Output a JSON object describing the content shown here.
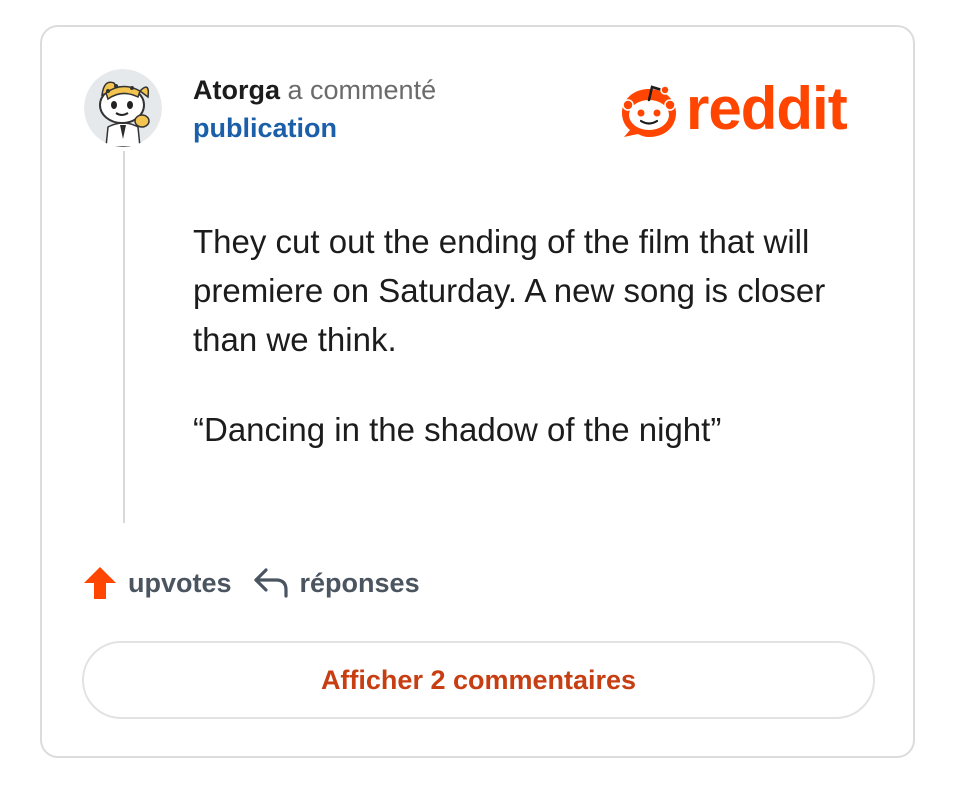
{
  "comment": {
    "author": "Atorga",
    "action_text": "a commenté",
    "post_link": "publication",
    "body": [
      "They cut out the ending of the film that will premiere on Saturday. A new song is closer than we think.",
      "“Dancing in the shadow of the night”"
    ]
  },
  "brand": {
    "name": "reddit",
    "color": "#ff4500"
  },
  "actions": {
    "upvotes_label": "upvotes",
    "replies_label": "réponses"
  },
  "show_comments_button": {
    "label": "Afficher 2 commentaires"
  },
  "icons": {
    "avatar": "snoo-avatar",
    "upvote": "upvote-arrow-icon",
    "reply": "reply-arrow-icon",
    "logo": "reddit-snoo-icon"
  },
  "colors": {
    "author_text": "#1c1c1c",
    "link": "#1a5fa8",
    "muted": "#6b6b6b",
    "upvote": "#ff4500",
    "button_text": "#c63e12"
  }
}
